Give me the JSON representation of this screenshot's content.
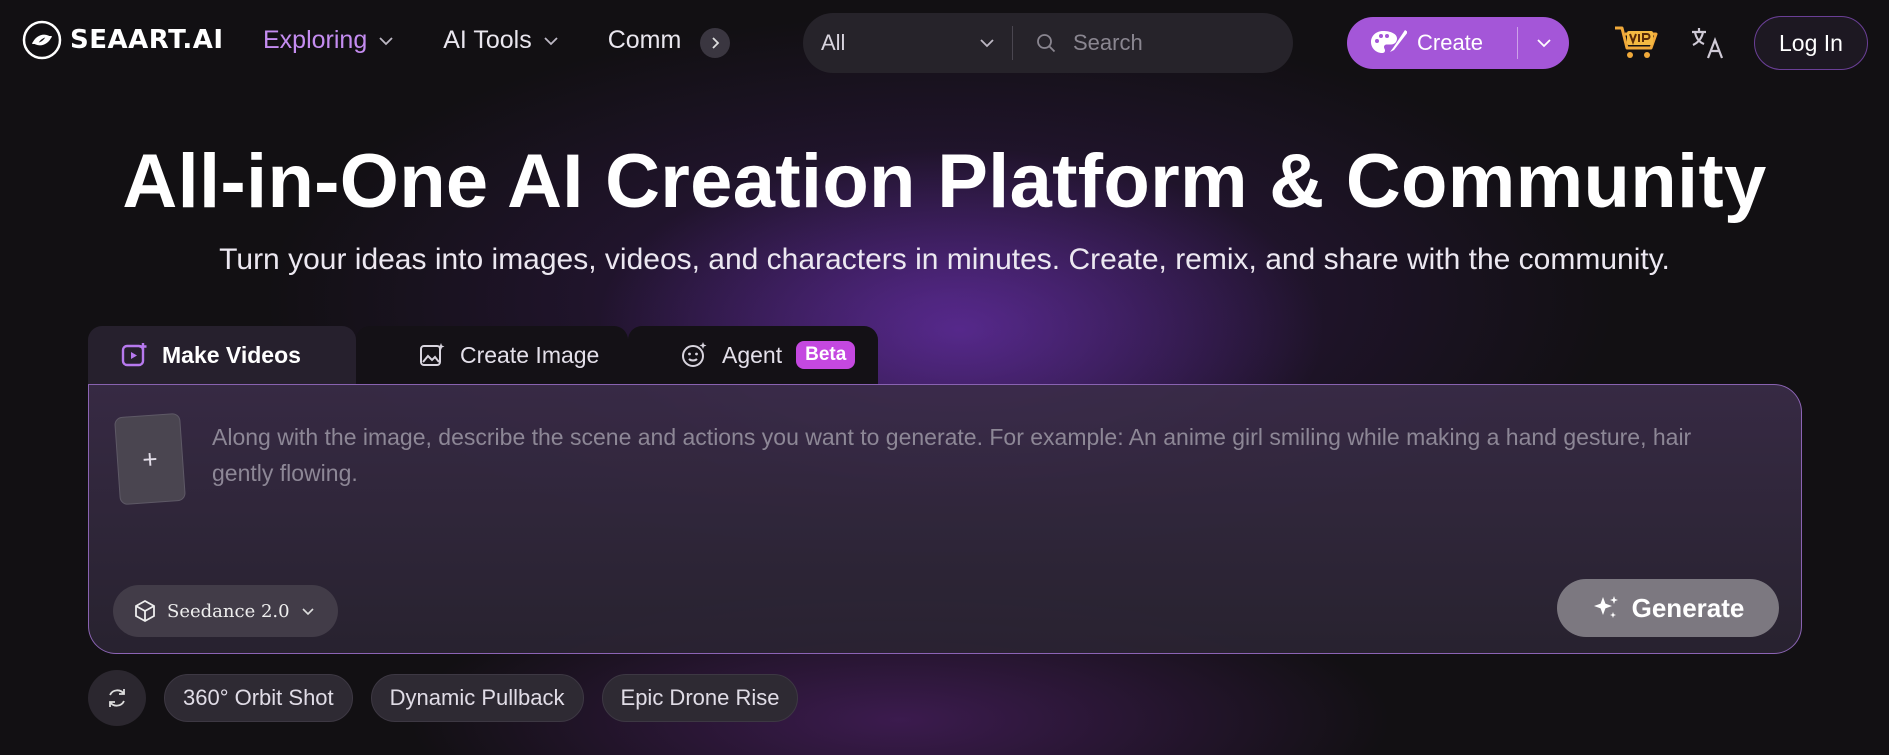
{
  "brand": {
    "name": "SEAART.AI"
  },
  "nav": {
    "items": [
      {
        "label": "Exploring",
        "active": true
      },
      {
        "label": "AI Tools"
      },
      {
        "label": "Comm"
      }
    ]
  },
  "search": {
    "category": "All",
    "placeholder": "Search"
  },
  "header": {
    "create_label": "Create",
    "login_label": "Log In"
  },
  "hero": {
    "title": "All-in-One AI Creation Platform & Community",
    "subtitle": "Turn your ideas into images, videos, and characters in minutes. Create, remix, and share with the community."
  },
  "tabs": [
    {
      "label": "Make Videos",
      "active": true
    },
    {
      "label": "Create Image"
    },
    {
      "label": "Agent",
      "badge": "Beta"
    }
  ],
  "prompt": {
    "upload_glyph": "+",
    "placeholder": "Along with the image, describe the scene and actions you want to generate. For example: An anime girl smiling while making a hand gesture, hair gently flowing.",
    "model": "Seedance 2.0",
    "generate_label": "Generate"
  },
  "chips": [
    "360° Orbit Shot",
    "Dynamic Pullback",
    "Epic Drone Rise"
  ],
  "colors": {
    "accent": "#a456d8",
    "nav_active": "#c48cf0",
    "beta": "#c448e0"
  }
}
